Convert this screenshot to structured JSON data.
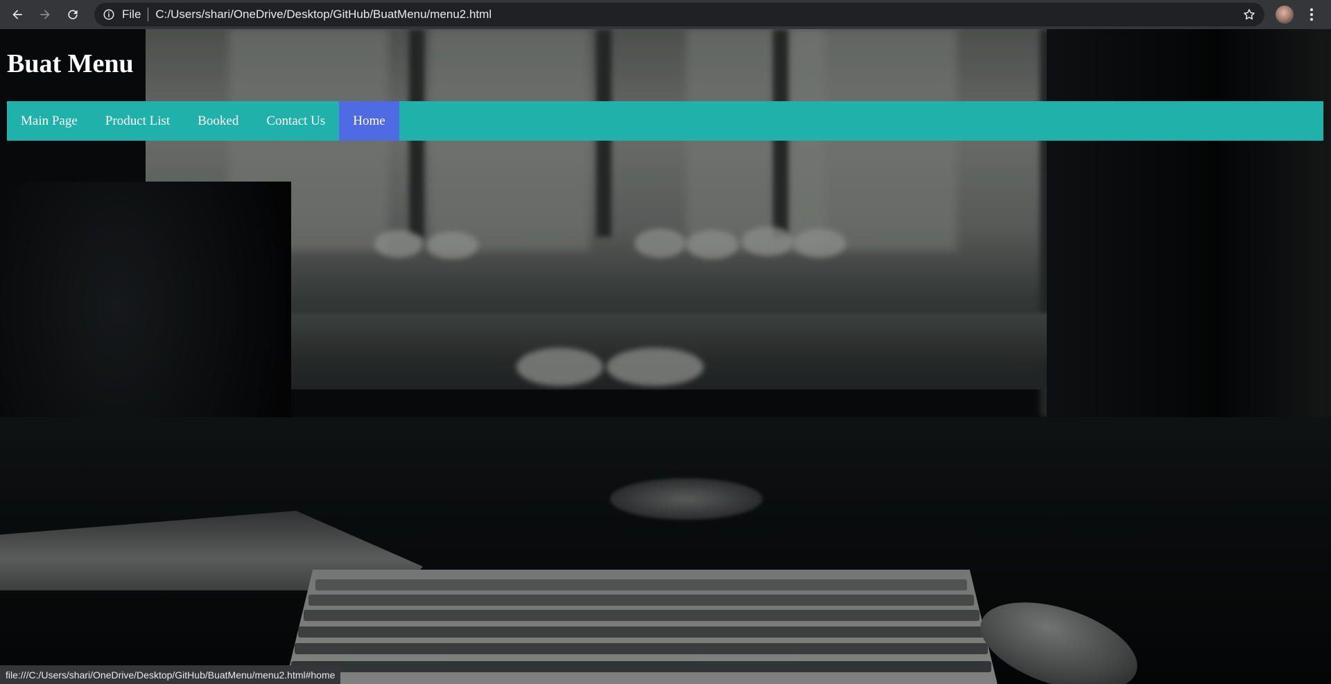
{
  "browser": {
    "address_scheme": "File",
    "address_url": "C:/Users/shari/OneDrive/Desktop/GitHub/BuatMenu/menu2.html",
    "icons": {
      "back": "arrow-left-icon",
      "forward": "arrow-right-icon",
      "reload": "reload-icon",
      "info": "info-icon",
      "bookmark": "star-icon",
      "profile": "avatar",
      "menu": "kebab-menu-icon"
    }
  },
  "page": {
    "title": "Buat Menu",
    "nav": {
      "items": [
        {
          "label": "Main Page",
          "active": false
        },
        {
          "label": "Product List",
          "active": false
        },
        {
          "label": "Booked",
          "active": false
        },
        {
          "label": "Contact Us",
          "active": false
        },
        {
          "label": "Home",
          "active": true
        }
      ]
    }
  },
  "status_bar": {
    "text": "file:///C:/Users/shari/OneDrive/Desktop/GitHub/BuatMenu/menu2.html#home"
  },
  "colors": {
    "nav_bg": "#20b2aa",
    "nav_active_bg": "#4f6be3",
    "chrome_bg": "#35363a",
    "omnibox_bg": "#202124"
  }
}
